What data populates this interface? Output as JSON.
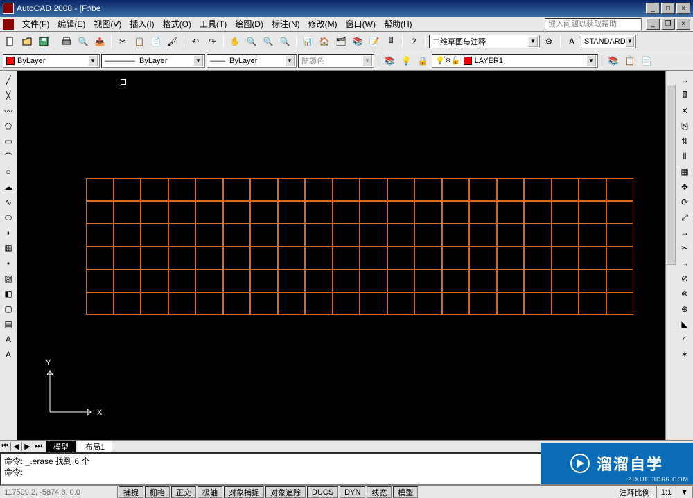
{
  "title": "AutoCAD 2008 - [F:\\be",
  "menus": [
    "文件(F)",
    "编辑(E)",
    "视图(V)",
    "插入(I)",
    "格式(O)",
    "工具(T)",
    "绘图(D)",
    "标注(N)",
    "修改(M)",
    "窗口(W)",
    "帮助(H)"
  ],
  "help_placeholder": "键入问题以获取帮助",
  "workspace_label": "二维草图与注释",
  "style_label": "STANDARD",
  "layer_color_combo": "ByLayer",
  "linetype_combo": "ByLayer",
  "lineweight_combo": "ByLayer",
  "color_combo": "随颜色",
  "layer_combo": "LAYER1",
  "tabs": {
    "model": "模型",
    "layout1": "布局1"
  },
  "cmd": {
    "line1": "命令: _.erase 找到 6 个",
    "line2": "命令:"
  },
  "status": {
    "coords": "117509.2, -5874.8, 0.0",
    "snap": "捕捉",
    "grid": "栅格",
    "ortho": "正交",
    "polar": "极轴",
    "osnap": "对象捕捉",
    "otrack": "对象追踪",
    "ducs": "DUCS",
    "dyn": "DYN",
    "lwt": "线宽",
    "model": "模型",
    "annoscale_label": "注释比例:",
    "annoscale": "1:1"
  },
  "ucs": {
    "x": "X",
    "y": "Y"
  },
  "grid": {
    "cols": 20,
    "rows": 6
  },
  "watermark": {
    "text": "溜溜自学",
    "sub": "ZIXUE.3D66.COM"
  },
  "left_tools": [
    "line",
    "xline",
    "pline",
    "polygon",
    "rect",
    "arc",
    "circle",
    "revcloud",
    "spline",
    "ellipse",
    "ellipsearc",
    "block",
    "point",
    "hatch",
    "gradient",
    "region",
    "table",
    "mtext",
    "text"
  ],
  "right_tools": [
    "dist",
    "quickcalc",
    "erase",
    "copy",
    "mirror",
    "offset",
    "array",
    "move",
    "rotate",
    "scale",
    "stretch",
    "trim",
    "extend",
    "break",
    "breakpt",
    "join",
    "chamfer",
    "fillet",
    "explode"
  ]
}
